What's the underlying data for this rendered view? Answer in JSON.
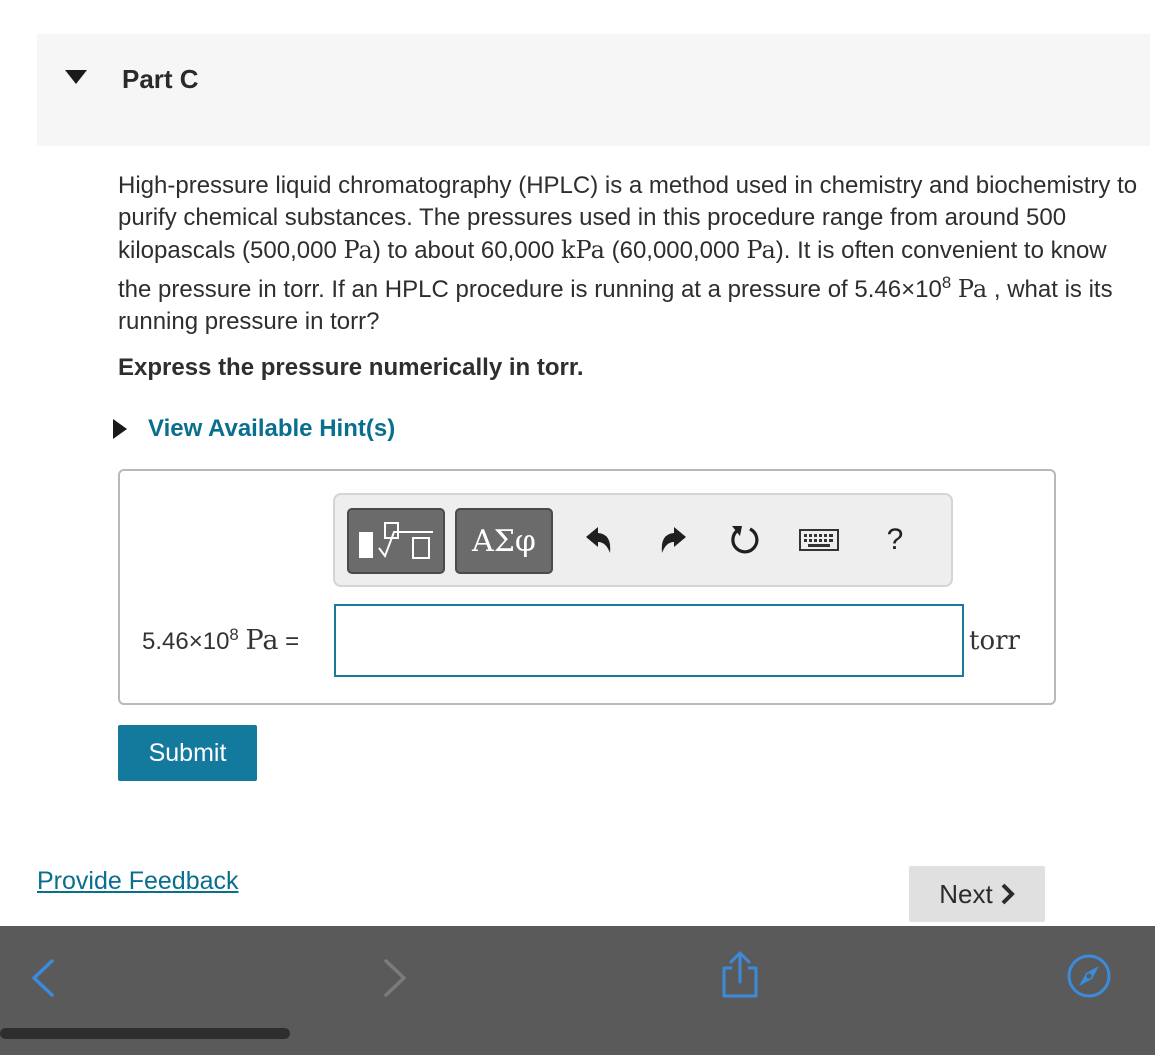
{
  "part": {
    "title": "Part C"
  },
  "problem": {
    "segments": [
      {
        "kind": "text",
        "value": "High-pressure liquid chromatography (HPLC) is a method used in chemistry and biochemistry to purify chemical substances. The pressures used in this procedure range from around 500 kilopascals (500,000 "
      },
      {
        "kind": "math",
        "value": "Pa"
      },
      {
        "kind": "text",
        "value": ") to about 60,000 "
      },
      {
        "kind": "math",
        "value": "kPa"
      },
      {
        "kind": "text",
        "value": " (60,000,000 "
      },
      {
        "kind": "math",
        "value": "Pa"
      },
      {
        "kind": "text",
        "value": "). It is often convenient to know the pressure in torr. If an HPLC procedure is running at a pressure of 5.46×10"
      },
      {
        "kind": "sup",
        "value": "8"
      },
      {
        "kind": "text",
        "value": " "
      },
      {
        "kind": "math",
        "value": "Pa"
      },
      {
        "kind": "text",
        "value": " , what is its running pressure in torr?"
      }
    ],
    "instruction": "Express the pressure numerically in torr."
  },
  "hint": {
    "label": "View Available Hint(s)"
  },
  "toolbar": {
    "greek_label": "ΑΣφ",
    "help_label": "?",
    "icons": [
      "template-icon",
      "undo-icon",
      "redo-icon",
      "reset-icon",
      "keyboard-icon",
      "help-icon"
    ]
  },
  "equation": {
    "base": "5.46×10",
    "exponent": "8",
    "unit": "Pa",
    "equals": "="
  },
  "answer": {
    "value": "",
    "unit": "torr"
  },
  "buttons": {
    "submit": "Submit",
    "next": "Next"
  },
  "feedback": {
    "label": "Provide Feedback"
  },
  "browser_bar": {
    "icons": [
      "back-icon",
      "forward-icon",
      "share-icon",
      "compass-icon"
    ]
  }
}
